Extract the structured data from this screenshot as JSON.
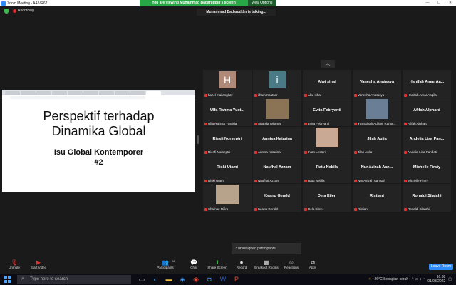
{
  "window": {
    "title": "Zoom Meeting - A4-VR62"
  },
  "viewing_banner": {
    "message": "You are viewing Muhammad Badaruddin's screen",
    "options_label": "View Options ▾"
  },
  "window_controls": {
    "minimize": "—",
    "maximize": "☐",
    "close": "✕"
  },
  "recording": {
    "label": "Recording"
  },
  "talking": {
    "text": "Muhammad Badaruddin is talking..."
  },
  "slide": {
    "line1": "Perspektif terhadap",
    "line2": "Dinamika Global",
    "line3": "Isu Global Kontemporer",
    "line4": "#2"
  },
  "gallery": {
    "up_arrow": "︿",
    "tiles": [
      {
        "name": "",
        "avatar": "H",
        "avatar_color": "#b08979",
        "label": "hazel mailangkay"
      },
      {
        "name": "",
        "avatar": "i",
        "avatar_color": "#4a7a86",
        "label": "ilham Kautsar"
      },
      {
        "name": "Alwi sihaf",
        "label": "Alwi sihaf"
      },
      {
        "name": "Vanesha Anatasya",
        "label": "Vanesha Anatasya"
      },
      {
        "name": "Hanifah Amar Aa...",
        "label": "Hanifah Amar Aaqila"
      },
      {
        "name": "Ulfa Rahma Yust...",
        "label": "Ulfa Rahma Yustisia"
      },
      {
        "name": "",
        "photo": "#8a7455",
        "label": "Ananda Wilama"
      },
      {
        "name": "Evita Febryanti",
        "label": "Evita Febryanti"
      },
      {
        "name": "",
        "photo": "#6a7f96",
        "label": "Yusrotinah Adriani Rama..."
      },
      {
        "name": "Afifah Alphard",
        "label": "Afifah Alphard"
      },
      {
        "name": "Riesfi Norseptri",
        "label": "Riesfi Norseptri"
      },
      {
        "name": "Annisa Katarina",
        "label": "Annisa Katarina"
      },
      {
        "name": "",
        "photo": "#c9a993",
        "label": "Intan Lestari"
      },
      {
        "name": "Jilah Aulia",
        "label": "Jilah Aulia"
      },
      {
        "name": "Andelia Lisa Pan...",
        "label": "Andelia Lisa Pandeti"
      },
      {
        "name": "Riski Utami",
        "label": "Riski Utami"
      },
      {
        "name": "Naufhal Azzam",
        "label": "Naufhal Azzam"
      },
      {
        "name": "Ratu Nebila",
        "label": "Ratu Nebila"
      },
      {
        "name": "Nur Azizah Aan...",
        "label": "Nur Azizah Aanisah"
      },
      {
        "name": "Michelle Firsty",
        "label": "Michelle Firsty"
      },
      {
        "name": "",
        "photo": "#b7a38c",
        "label": "Shafnaz Rifira"
      },
      {
        "name": "Keanu Gerald",
        "label": "Keanu Gerald"
      },
      {
        "name": "Dela Eilen",
        "label": "Dela Eilen"
      },
      {
        "name": "Ristiani",
        "label": "Ristiani"
      },
      {
        "name": "Ronaldi Silalahi",
        "label": "Ronaldi Silalahi"
      }
    ]
  },
  "unassigned": {
    "text": "3 unassigned participants"
  },
  "toolbar": {
    "unmute": "Unmute",
    "start_video": "Start Video",
    "participants": "Participants",
    "participants_count": "41",
    "chat": "Chat",
    "share_screen": "Share Screen",
    "record": "Record",
    "breakout": "Breakout Rooms",
    "reactions": "Reactions",
    "apps": "Apps",
    "leave": "Leave Room"
  },
  "taskbar": {
    "search_placeholder": "Type here to search",
    "weather": "26°C Sebagian cerah",
    "time": "10:38",
    "date": "01/03/2022"
  },
  "colors": {
    "accent": "#2d8cff",
    "share_green": "#27a745",
    "mute_red": "#e03434"
  }
}
